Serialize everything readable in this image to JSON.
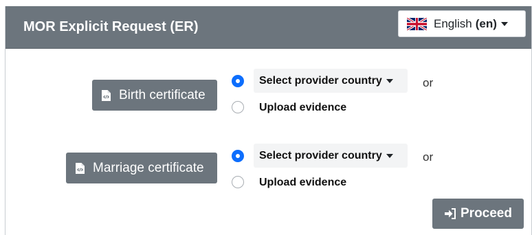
{
  "header": {
    "title": "MOR Explicit Request (ER)",
    "language": {
      "label": "English",
      "code": "(en)",
      "flag_icon": "uk-flag-icon"
    }
  },
  "requests": [
    {
      "document_label": "Birth certificate",
      "document_icon": "file-code-icon",
      "options": [
        {
          "label": "Select provider country",
          "selected": true
        },
        {
          "label": "Upload evidence",
          "selected": false
        }
      ],
      "separator": "or"
    },
    {
      "document_label": "Marriage certificate",
      "document_icon": "file-code-icon",
      "options": [
        {
          "label": "Select provider country",
          "selected": true
        },
        {
          "label": "Upload evidence",
          "selected": false
        }
      ],
      "separator": "or"
    }
  ],
  "actions": {
    "proceed_label": "Proceed",
    "proceed_icon": "sign-in-icon"
  },
  "colors": {
    "header_bg": "#6c757d",
    "button_bg": "#6c757d",
    "radio_checked": "#0d6efd"
  }
}
